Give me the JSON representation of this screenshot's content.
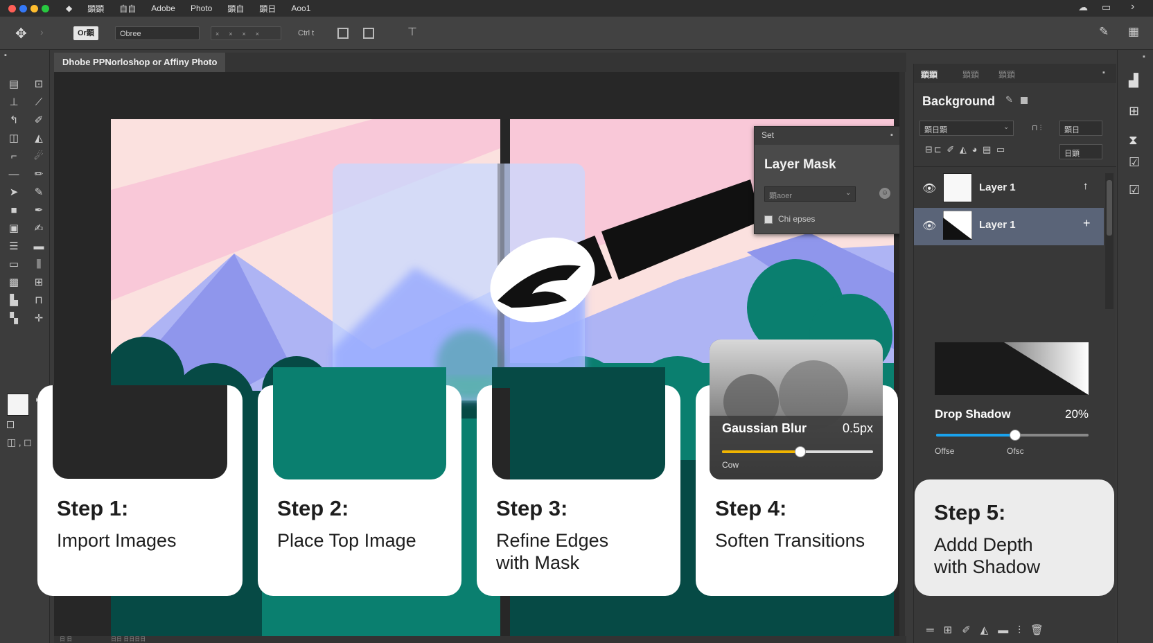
{
  "menubar": {
    "items": [
      "顕顕",
      "自自",
      "Adobe",
      "Photo",
      "顕自",
      "顕日",
      "Aoo1"
    ]
  },
  "options": {
    "mode_button": "Or顕",
    "field_value": "Obree",
    "nums_label": "Ctrl t"
  },
  "document": {
    "tab_title": "Dhobe  PPNorloshop or Affiny Photo",
    "status_left": "日 日",
    "status_right": "日日 日日日日"
  },
  "mask_panel": {
    "tab_label": "Set",
    "title": "Layer Mask",
    "dropdown_value": "顕aoer",
    "checkbox_label": "Chi epses"
  },
  "blur_panel": {
    "label": "Gaussian Blur",
    "value": "0.5px",
    "slider_fraction": 0.52,
    "slider_label": "Cow"
  },
  "layers_panel": {
    "tabs": [
      "顕顕",
      "顕顕",
      "顕顕"
    ],
    "title": "Background",
    "blend_value": "顕日顕",
    "opacity_value": "顕日",
    "fill_value": "日顕",
    "layers": [
      {
        "name": "Layer 1",
        "selected": false
      },
      {
        "name": "Layer 1",
        "selected": true
      }
    ],
    "effect_label": "Drop Shadow",
    "effect_value": "20%",
    "effect_fraction": 0.52,
    "offset_left": "Offse",
    "offset_right": "Ofsc"
  },
  "steps": [
    {
      "title": "Step 1:",
      "desc": "Import Images"
    },
    {
      "title": "Step 2:",
      "desc": "Place Top Image"
    },
    {
      "title": "Step 3:",
      "desc": "Refine Edges\nwith Mask"
    },
    {
      "title": "Step 4:",
      "desc": "Soften Transitions"
    },
    {
      "title": "Step 5:",
      "desc": "Addd Depth\nwith Shadow"
    }
  ],
  "colors": {
    "accent": "#1aa3ee",
    "slider_yellow": "#f0b400",
    "teal": "#0a7f6f",
    "dark_teal": "#064a45",
    "pink": "#f9c8d8",
    "lavender": "#aeb4f4"
  }
}
